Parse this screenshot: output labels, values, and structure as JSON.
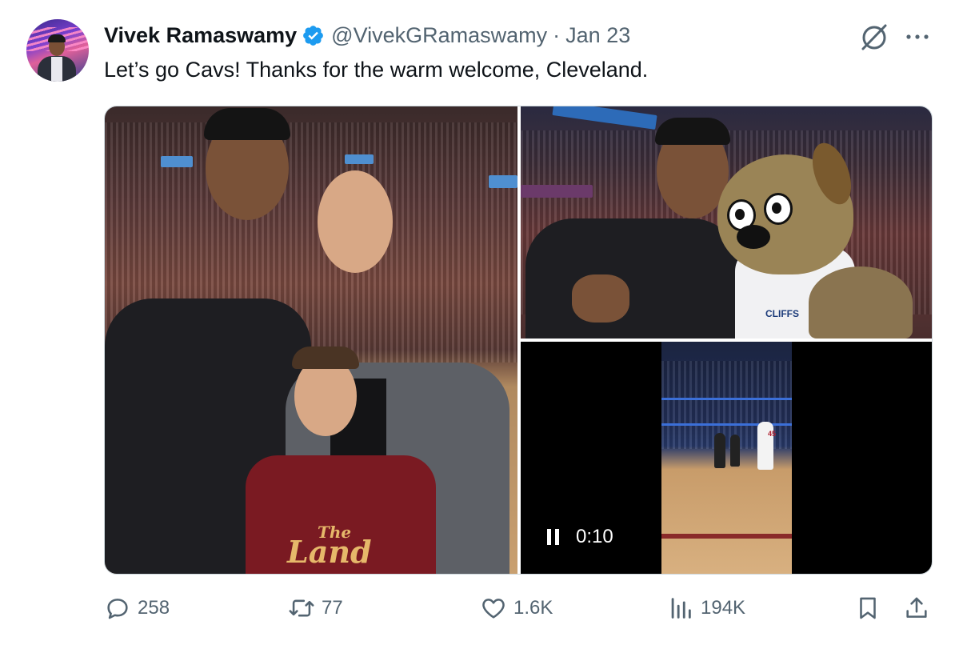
{
  "author": {
    "name": "Vivek Ramaswamy",
    "handle": "@VivekGRamaswamy",
    "separator": "·",
    "date": "Jan 23",
    "verified_color": "#1d9bf0"
  },
  "tweet": {
    "text": "Let’s go Cavs! Thanks for the warm welcome, Cleveland."
  },
  "media": {
    "photo1": {
      "jersey_line1": "The",
      "jersey_line2": "Land"
    },
    "photo2": {
      "jersey_text": "CLIFFS"
    },
    "video": {
      "elapsed": "0:10",
      "state": "playing",
      "player_number": "45"
    }
  },
  "actions": {
    "replies": "258",
    "reposts": "77",
    "likes": "1.6K",
    "views": "194K"
  },
  "icons": {
    "grok": "grok-icon",
    "more": "more-icon",
    "reply": "reply-icon",
    "repost": "repost-icon",
    "like": "heart-icon",
    "views": "views-icon",
    "bookmark": "bookmark-icon",
    "share": "share-icon"
  },
  "colors": {
    "text": "#0f1419",
    "secondary": "#536471",
    "border": "#cfd9de"
  }
}
